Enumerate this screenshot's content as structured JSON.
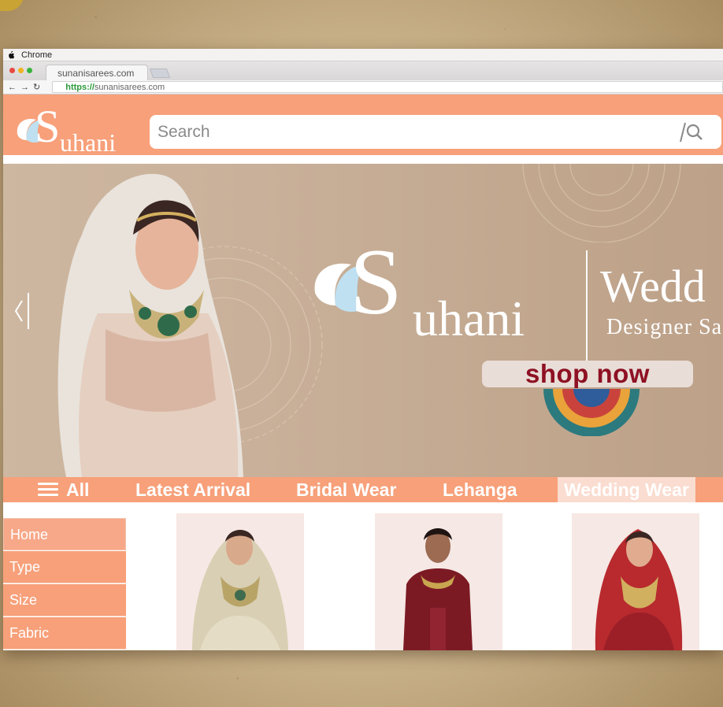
{
  "os": {
    "app_name": "Chrome"
  },
  "browser": {
    "tab_title": "sunanisarees.com",
    "url_scheme": "https://",
    "url_host": "sunanisarees.com"
  },
  "site": {
    "brand": "uhani",
    "brand_initial": "S",
    "search_placeholder": "Search",
    "colors": {
      "primary": "#f7a07a",
      "accent": "#8e1123",
      "active_tab": "#fadcd0"
    }
  },
  "hero": {
    "brand": "uhani",
    "brand_initial": "S",
    "title": "Wedd",
    "subtitle": "Designer Sa",
    "cta": "shop now"
  },
  "categories": [
    "All",
    "Latest Arrival",
    "Bridal Wear",
    "Lehanga",
    "Wedding Wear"
  ],
  "active_category": "Wedding Wear",
  "sidebar": [
    "Home",
    "Type",
    "Size",
    "Fabric"
  ],
  "products": [
    {
      "name": "product-ivory-lehenga"
    },
    {
      "name": "product-maroon-saree"
    },
    {
      "name": "product-red-bridal-lehenga"
    }
  ]
}
